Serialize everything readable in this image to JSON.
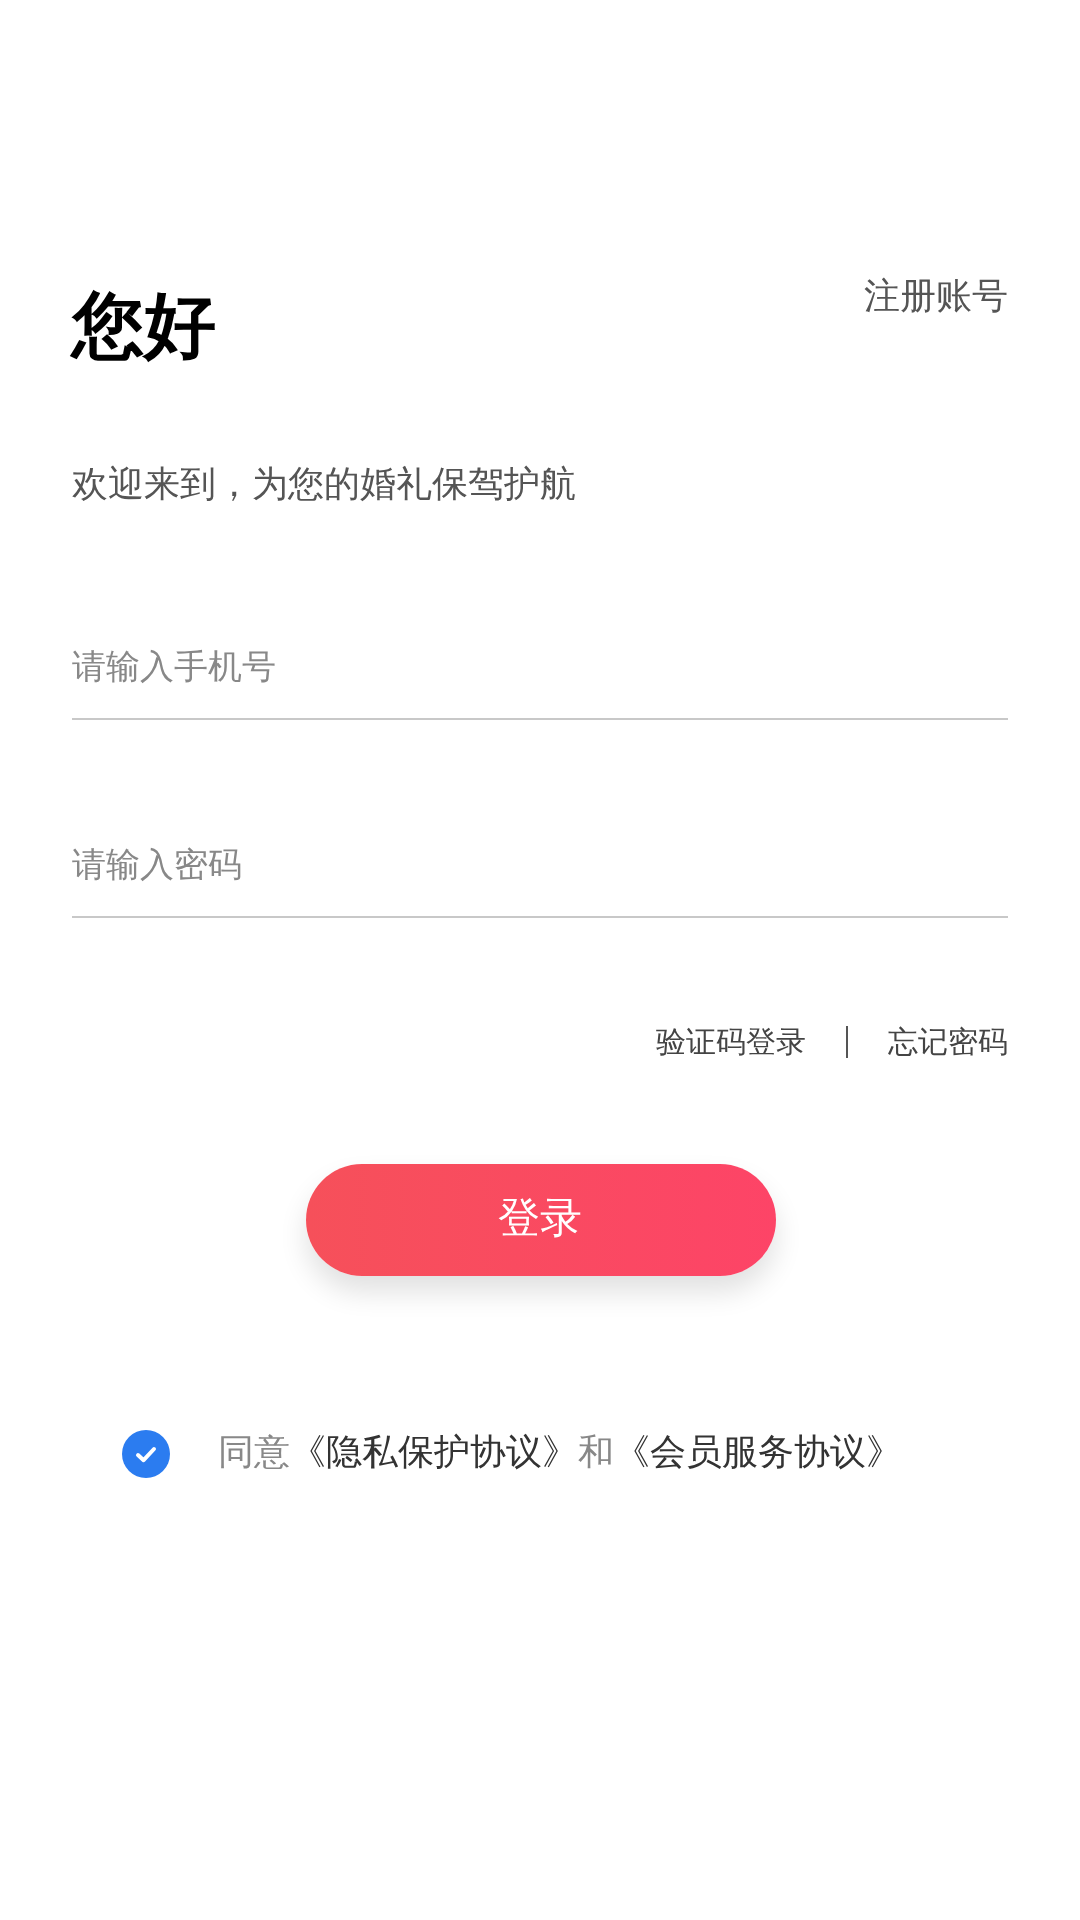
{
  "header": {
    "title": "您好",
    "register_link": "注册账号"
  },
  "subtitle": "欢迎来到，为您的婚礼保驾护航",
  "fields": [
    {
      "placeholder": "请输入手机号"
    },
    {
      "placeholder": "请输入密码"
    }
  ],
  "links": [
    "验证码登录",
    "忘记密码"
  ],
  "login_button": "登录",
  "agreement": {
    "checked": true,
    "prefix": "同意",
    "privacy_link": "《隐私保护协议》",
    "conjunction": "和",
    "member_link": "《会员服务协议》"
  }
}
